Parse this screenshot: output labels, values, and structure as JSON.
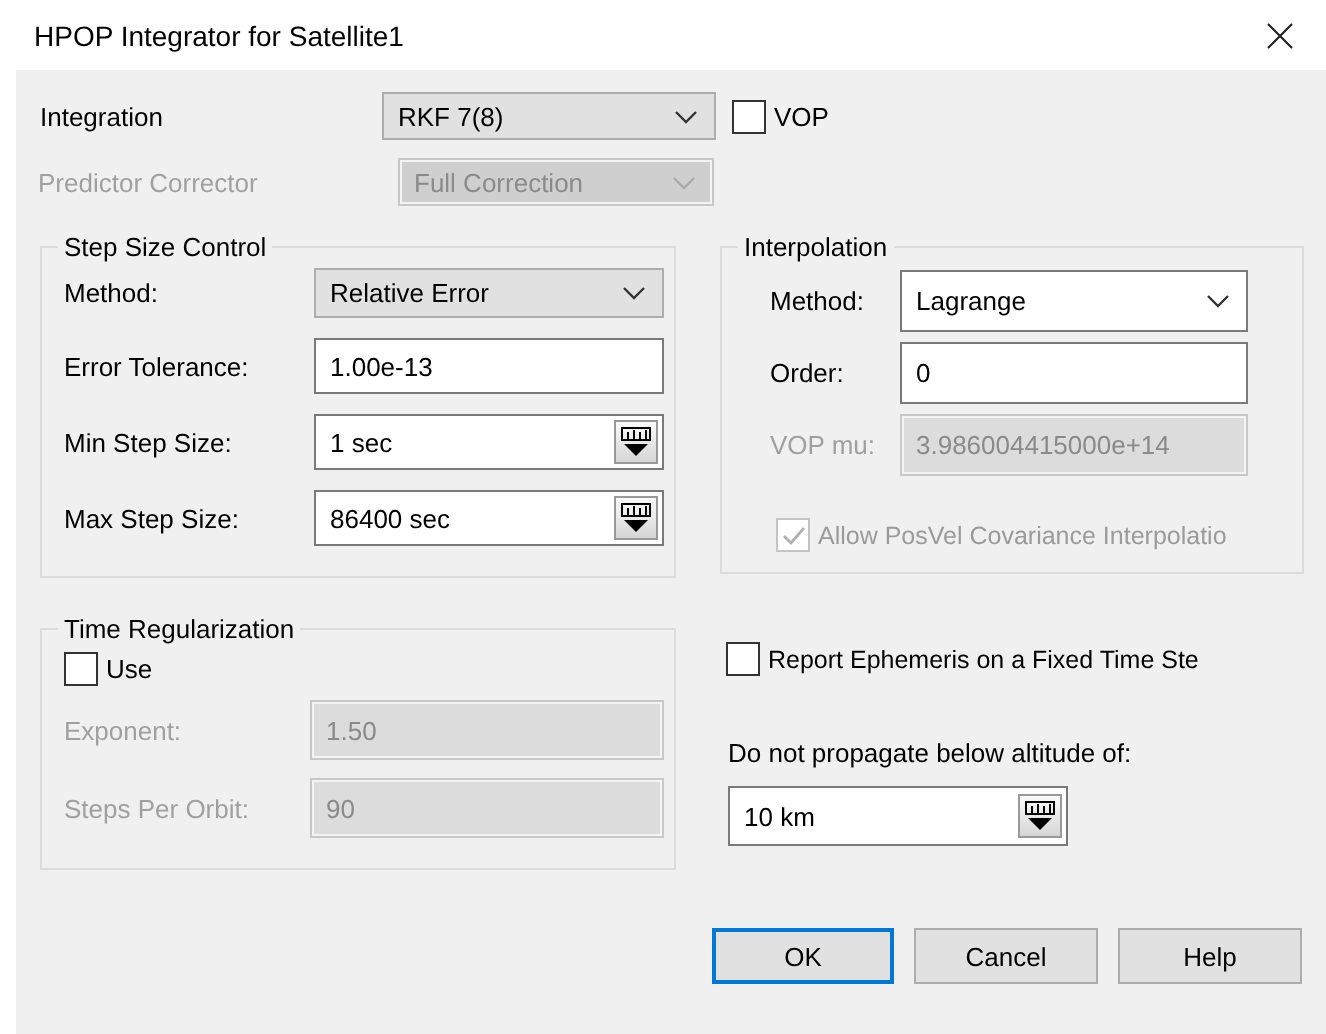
{
  "window": {
    "title": "HPOP Integrator for Satellite1"
  },
  "integration": {
    "label": "Integration",
    "value": "RKF 7(8)",
    "disabled": false
  },
  "vop": {
    "label": "VOP",
    "checked": false
  },
  "predictor_corrector": {
    "label": "Predictor Corrector",
    "value": "Full Correction",
    "disabled": true
  },
  "step_size_control": {
    "title": "Step Size Control",
    "rows": [
      {
        "kind": "combo",
        "label": "Method:",
        "value": "Relative Error",
        "disabled": false
      },
      {
        "kind": "field",
        "label": "Error Tolerance:",
        "value": "1.00e-13",
        "disabled": false
      },
      {
        "kind": "unit_field",
        "label": "Min Step Size:",
        "value": "1 sec",
        "disabled": false
      },
      {
        "kind": "unit_field",
        "label": "Max Step Size:",
        "value": "86400 sec",
        "disabled": false
      }
    ]
  },
  "interpolation": {
    "title": "Interpolation",
    "rows": [
      {
        "kind": "combo",
        "label": "Method:",
        "value": "Lagrange",
        "disabled": false
      },
      {
        "kind": "field",
        "label": "Order:",
        "value": "0",
        "disabled": false
      },
      {
        "kind": "field",
        "label": "VOP mu:",
        "value": "3.986004415000e+14",
        "disabled": true
      }
    ],
    "allow_covariance": {
      "label": "Allow PosVel Covariance Interpolatio",
      "checked": true,
      "disabled": true
    }
  },
  "time_regularization": {
    "title": "Time Regularization",
    "use": {
      "label": "Use",
      "checked": false
    },
    "rows": [
      {
        "kind": "field",
        "label": "Exponent:",
        "value": "1.50",
        "disabled": true
      },
      {
        "kind": "field",
        "label": "Steps Per Orbit:",
        "value": "90",
        "disabled": true
      }
    ]
  },
  "report_fixed_step": {
    "label": "Report Ephemeris on a Fixed Time Ste",
    "checked": false
  },
  "min_altitude": {
    "label": "Do not propagate below altitude of:",
    "value": "10 km",
    "kind": "unit_field",
    "disabled": false
  },
  "buttons": [
    {
      "label": "OK",
      "default": true
    },
    {
      "label": "Cancel",
      "default": false
    },
    {
      "label": "Help",
      "default": false
    }
  ]
}
